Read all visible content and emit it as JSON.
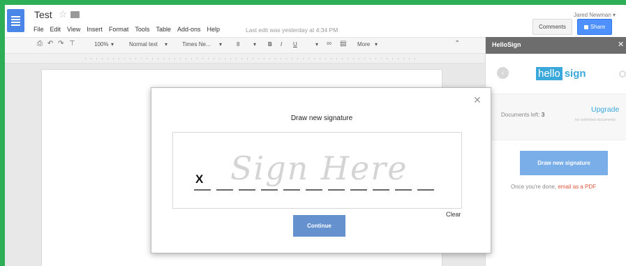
{
  "header": {
    "doc_title": "Test",
    "menu": [
      "File",
      "Edit",
      "View",
      "Insert",
      "Format",
      "Tools",
      "Table",
      "Add-ons",
      "Help"
    ],
    "last_edit": "Last edit was yesterday at 4:34 PM",
    "user_name": "Jared Newman",
    "comments_label": "Comments",
    "share_label": "Share"
  },
  "toolbar": {
    "zoom": "100%",
    "style": "Normal text",
    "font": "Times Ne...",
    "font_size": "8",
    "bold": "B",
    "italic": "I",
    "underline": "U",
    "more": "More"
  },
  "sidebar": {
    "title": "HelloSign",
    "logo_hello": "hello",
    "logo_sign": "sign",
    "documents_left_label": "Documents left:",
    "documents_left_value": "3",
    "upgrade_label": "Upgrade",
    "upgrade_sub": "for unlimited documents",
    "draw_button": "Draw new signature",
    "hint_prefix": "Once you're done,",
    "hint_link": "email as a PDF"
  },
  "modal": {
    "title": "Draw new signature",
    "sig_mark": "X",
    "sig_placeholder": "Sign Here",
    "clear_label": "Clear",
    "continue_label": "Continue"
  },
  "colors": {
    "accent_blue": "#4d90fe",
    "hellosign_blue": "#3aa8db",
    "link_red": "#e0563b",
    "border_green": "#2eaf57"
  }
}
